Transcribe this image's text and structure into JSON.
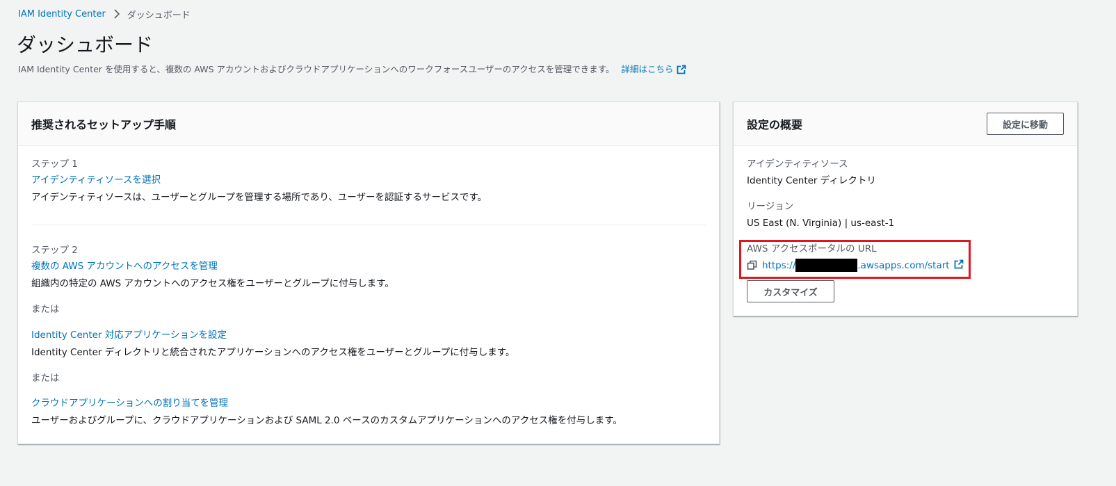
{
  "breadcrumb": {
    "root": "IAM Identity Center",
    "current": "ダッシュボード"
  },
  "header": {
    "title": "ダッシュボード",
    "description": "IAM Identity Center を使用すると、複数の AWS アカウントおよびクラウドアプリケーションへのワークフォースユーザーのアクセスを管理できます。",
    "learn_more": "詳細はこちら"
  },
  "setup": {
    "title": "推奨されるセットアップ手順",
    "step1": {
      "label": "ステップ 1",
      "link": "アイデンティティソースを選択",
      "desc": "アイデンティティソースは、ユーザーとグループを管理する場所であり、ユーザーを認証するサービスです。"
    },
    "step2": {
      "label": "ステップ 2",
      "link1": "複数の AWS アカウントへのアクセスを管理",
      "desc1": "組織内の特定の AWS アカウントへのアクセス権をユーザーとグループに付与します。",
      "or1": "または",
      "link2": "Identity Center 対応アプリケーションを設定",
      "desc2": "Identity Center ディレクトリと統合されたアプリケーションへのアクセス権をユーザーとグループに付与します。",
      "or2": "または",
      "link3": "クラウドアプリケーションへの割り当てを管理",
      "desc3": "ユーザーおよびグループに、クラウドアプリケーションおよび SAML 2.0 ベースのカスタムアプリケーションへのアクセス権を付与します。"
    }
  },
  "summary": {
    "title": "設定の概要",
    "goto_button": "設定に移動",
    "identity_source_label": "アイデンティティソース",
    "identity_source_value": "Identity Center ディレクトリ",
    "region_label": "リージョン",
    "region_value": "US East (N. Virginia) | us-east-1",
    "portal_label": "AWS アクセスポータルの URL",
    "portal_url_prefix": "https://",
    "portal_url_suffix": ".awsapps.com/start",
    "customize_button": "カスタマイズ"
  },
  "colors": {
    "link": "#0073bb",
    "highlight": "#e0161f"
  }
}
